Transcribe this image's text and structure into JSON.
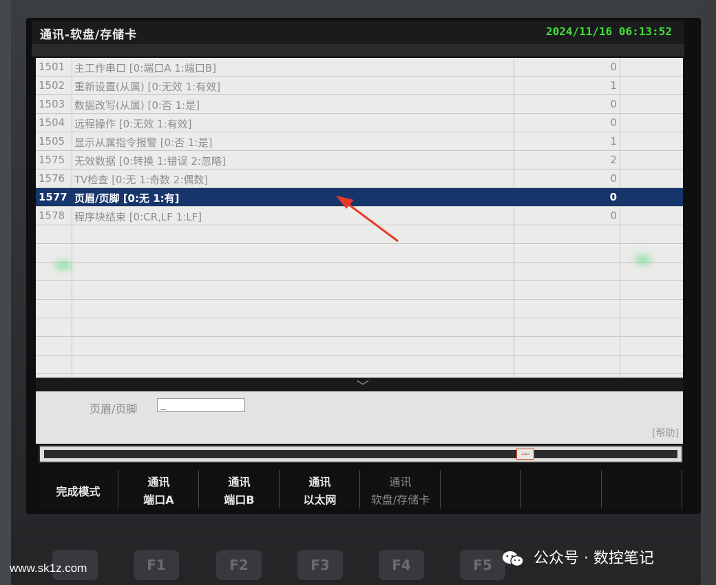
{
  "screen": {
    "title": "通讯-软盘/存储卡",
    "datetime": "2024/11/16 06:13:52"
  },
  "params": [
    {
      "num": "1501",
      "name": "主工作串口 [0:端口A  1:端口B]",
      "value": "0"
    },
    {
      "num": "1502",
      "name": "重新设置(从属) [0:无效  1:有效]",
      "value": "1"
    },
    {
      "num": "1503",
      "name": "数据改写(从属) [0:否  1:是]",
      "value": "0"
    },
    {
      "num": "1504",
      "name": "远程操作 [0:无效  1:有效]",
      "value": "0"
    },
    {
      "num": "1505",
      "name": "显示从属指令报警 [0:否  1:是]",
      "value": "1"
    },
    {
      "num": "1575",
      "name": "无效数据 [0:转换  1:错误  2:忽略]",
      "value": "2"
    },
    {
      "num": "1576",
      "name": "TV检查 [0:无  1:奇数  2:偶数]",
      "value": "0"
    },
    {
      "num": "1577",
      "name": "页眉/页脚 [0:无  1:有]",
      "value": "0",
      "selected": true
    },
    {
      "num": "1578",
      "name": "程序块结束 [0:CR,LF  1:LF]",
      "value": "0"
    }
  ],
  "input": {
    "label": "页眉/页脚",
    "value": "_"
  },
  "help_label": "[帮助]",
  "status_icon": "card-icon",
  "softkeys": [
    {
      "l1": "完成模式",
      "l2": ""
    },
    {
      "l1": "通讯",
      "l2": "端口A"
    },
    {
      "l1": "通讯",
      "l2": "端口B"
    },
    {
      "l1": "通讯",
      "l2": "以太网"
    },
    {
      "l1": "通讯",
      "l2": "软盘/存储卡",
      "dim": true
    },
    {
      "l1": "",
      "l2": ""
    },
    {
      "l1": "",
      "l2": ""
    },
    {
      "l1": "",
      "l2": ""
    }
  ],
  "fkeys": [
    "",
    "F1",
    "F2",
    "F3",
    "F4",
    "F5"
  ],
  "watermark": {
    "left": "www.sk1z.com",
    "right": "公众号 · 数控笔记"
  },
  "colors": {
    "selected_row": "#16356b",
    "datetime": "#3fe03a",
    "arrow": "#e8382a"
  }
}
